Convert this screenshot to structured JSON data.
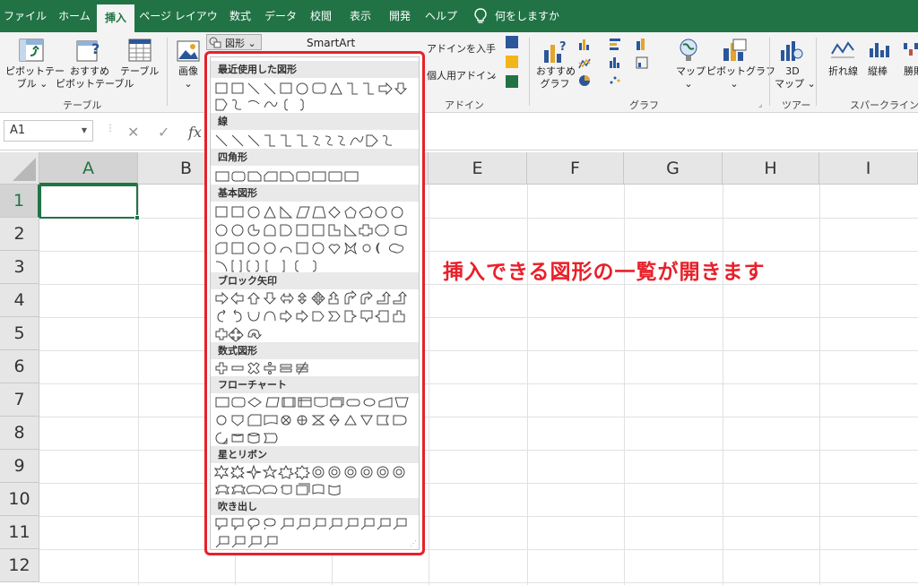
{
  "menu": {
    "tabs": [
      "ファイル",
      "ホーム",
      "挿入",
      "ページ レイアウト",
      "数式",
      "データ",
      "校閲",
      "表示",
      "開発",
      "ヘルプ"
    ],
    "active_tab": "挿入",
    "tell_me": "何をしますか"
  },
  "ribbon": {
    "pivot_table": "ピボットテー\nブル ⌄",
    "recommended_pivot": "おすすめ\nピボットテーブル",
    "table": "テーブル",
    "picture": "画像\n⌄",
    "shapes": "図形 ⌄",
    "smartart": "SmartArt",
    "get_addins": "アドインを入手",
    "my_addins": "個人用アドイン",
    "recommended_charts": "おすすめ\nグラフ",
    "maps": "マップ\n⌄",
    "pivot_chart": "ピボットグラフ\n⌄",
    "map3d": "3D\nマップ ⌄",
    "line_spark": "折れ線",
    "column_spark": "縦棒",
    "winloss_spark": "勝敗",
    "groups": {
      "table": "テーブル",
      "addins": "アドイン",
      "charts": "グラフ",
      "tours": "ツアー",
      "sparklines": "スパークライン"
    }
  },
  "formula_bar": {
    "name_box": "A1",
    "cancel": "✕",
    "enter": "✓",
    "fx": "fx"
  },
  "grid": {
    "columns": [
      "A",
      "B",
      "C",
      "D",
      "E",
      "F",
      "G",
      "H",
      "I"
    ],
    "rows": [
      "1",
      "2",
      "3",
      "4",
      "5",
      "6",
      "7",
      "8",
      "9",
      "10",
      "11",
      "12"
    ],
    "selected_cell": "A1"
  },
  "shapes_menu": {
    "sections": [
      {
        "title": "最近使用した図形"
      },
      {
        "title": "線"
      },
      {
        "title": "四角形"
      },
      {
        "title": "基本図形"
      },
      {
        "title": "ブロック矢印"
      },
      {
        "title": "数式図形"
      },
      {
        "title": "フローチャート"
      },
      {
        "title": "星とリボン"
      },
      {
        "title": "吹き出し"
      }
    ]
  },
  "annotation": "挿入できる図形の一覧が開きます",
  "colors": {
    "excel_green": "#217346",
    "highlight_red": "#e8202a"
  }
}
